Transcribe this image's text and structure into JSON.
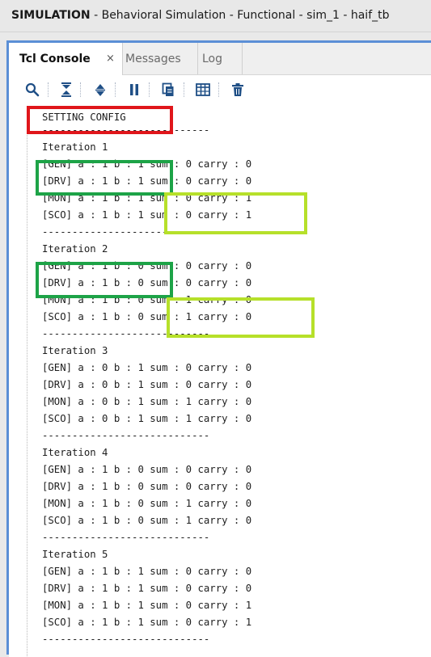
{
  "window": {
    "title_bold": "SIMULATION",
    "title_rest": " - Behavioral Simulation - Functional - sim_1 - haif_tb"
  },
  "tabs": [
    {
      "label": "Tcl Console",
      "active": true,
      "close": "×"
    },
    {
      "label": "Messages",
      "active": false
    },
    {
      "label": "Log",
      "active": false
    }
  ],
  "toolbar": {
    "buttons": [
      "search-icon",
      "collapse-all-icon",
      "expand-all-icon",
      "pause-icon",
      "copy-icon",
      "table-icon",
      "delete-icon"
    ]
  },
  "console": {
    "lines": [
      "SETTING CONFIG",
      "----------------------------",
      "Iteration 1",
      "[GEN] a : 1 b : 1 sum : 0 carry : 0",
      "[DRV] a : 1 b : 1 sum : 0 carry : 0",
      "[MON] a : 1 b : 1 sum : 0 carry : 1",
      "[SCO] a : 1 b : 1 sum : 0 carry : 1",
      "----------------------------",
      "Iteration 2",
      "[GEN] a : 1 b : 0 sum : 0 carry : 0",
      "[DRV] a : 1 b : 0 sum : 0 carry : 0",
      "[MON] a : 1 b : 0 sum : 1 carry : 0",
      "[SCO] a : 1 b : 0 sum : 1 carry : 0",
      "----------------------------",
      "Iteration 3",
      "[GEN] a : 0 b : 1 sum : 0 carry : 0",
      "[DRV] a : 0 b : 1 sum : 0 carry : 0",
      "[MON] a : 0 b : 1 sum : 1 carry : 0",
      "[SCO] a : 0 b : 1 sum : 1 carry : 0",
      "----------------------------",
      "Iteration 4",
      "[GEN] a : 1 b : 0 sum : 0 carry : 0",
      "[DRV] a : 1 b : 0 sum : 0 carry : 0",
      "[MON] a : 1 b : 0 sum : 1 carry : 0",
      "[SCO] a : 1 b : 0 sum : 1 carry : 0",
      "----------------------------",
      "Iteration 5",
      "[GEN] a : 1 b : 1 sum : 0 carry : 0",
      "[DRV] a : 1 b : 1 sum : 0 carry : 0",
      "[MON] a : 1 b : 1 sum : 0 carry : 1",
      "[SCO] a : 1 b : 1 sum : 0 carry : 1",
      "----------------------------"
    ]
  },
  "colors": {
    "red_box": "#e0161b",
    "green_box": "#1da347",
    "lime_box": "#b6e02a",
    "panel_border": "#5b8fd6"
  }
}
